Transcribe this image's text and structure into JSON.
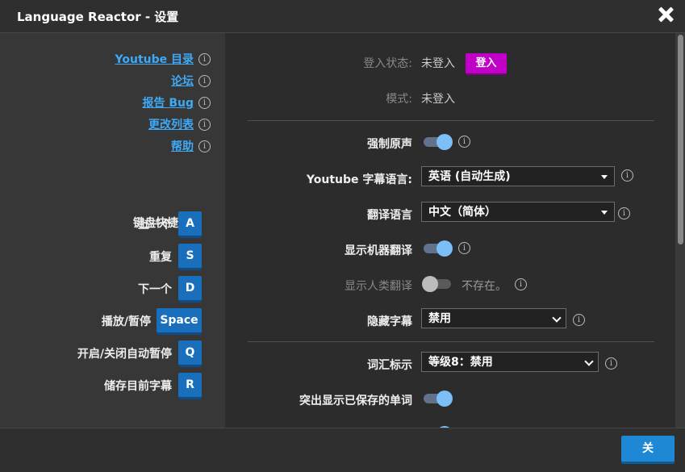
{
  "window": {
    "title": "Language Reactor - 设置"
  },
  "sidebar": {
    "links": [
      {
        "label": "Youtube 目录"
      },
      {
        "label": "论坛"
      },
      {
        "label": "报告 Bug"
      },
      {
        "label": "更改列表"
      },
      {
        "label": "帮助"
      }
    ],
    "keyboard_title": "键盘快捷键:",
    "shortcuts": [
      {
        "label": "上一个",
        "key": "A"
      },
      {
        "label": "重复",
        "key": "S"
      },
      {
        "label": "下一个",
        "key": "D"
      },
      {
        "label": "播放/暂停",
        "key": "Space"
      },
      {
        "label": "开启/关闭自动暂停",
        "key": "Q"
      },
      {
        "label": "储存目前字幕",
        "key": "R"
      }
    ]
  },
  "settings": {
    "login_status": {
      "label": "登入状态:",
      "value": "未登入",
      "button": "登入"
    },
    "mode": {
      "label": "模式:",
      "value": "未登入"
    },
    "force_original_audio": {
      "label": "强制原声",
      "on": true
    },
    "youtube_subtitle_language": {
      "label": "Youtube 字幕语言:",
      "value": "英语 (自动生成)"
    },
    "translation_language": {
      "label": "翻译语言",
      "value": "中文（简体）"
    },
    "show_machine_translation": {
      "label": "显示机器翻译",
      "on": true
    },
    "show_human_translation": {
      "label": "显示人类翻译",
      "on": false,
      "note": "不存在。"
    },
    "hide_subtitles": {
      "label": "隐藏字幕",
      "value": "禁用"
    },
    "vocab_highlight": {
      "label": "词汇标示",
      "value": "等级8：禁用"
    },
    "highlight_saved_words": {
      "label": "突出显示已保存的单词",
      "on": true
    }
  },
  "footer": {
    "close_label": "关"
  },
  "colors": {
    "accent": "#3fa9f5",
    "login_button": "#c000c6",
    "key": "#1a6fbd",
    "toggle_knob": "#7bbef8"
  }
}
